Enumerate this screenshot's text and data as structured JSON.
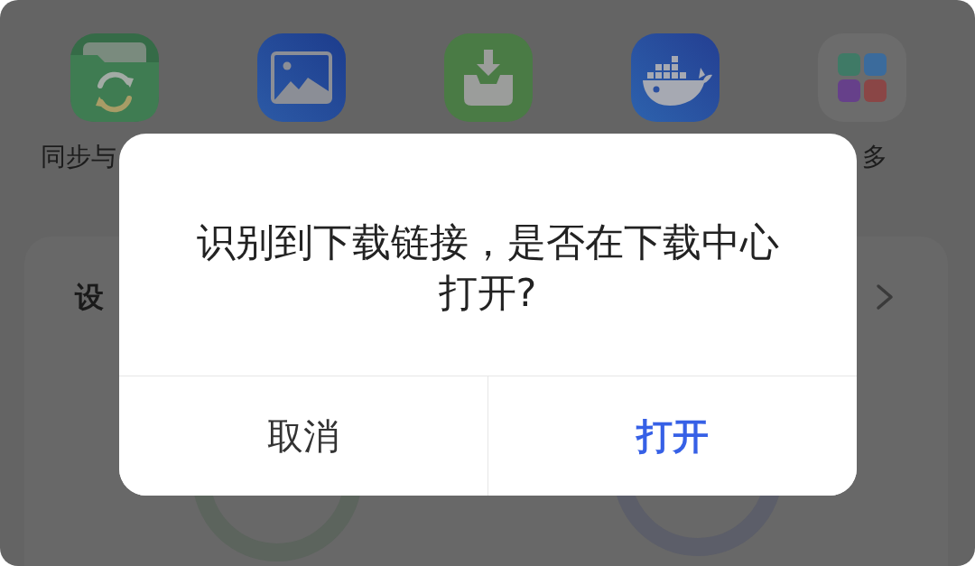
{
  "home": {
    "apps": [
      {
        "kind": "folder-sync",
        "label": "同步与"
      },
      {
        "kind": "picture"
      },
      {
        "kind": "download"
      },
      {
        "kind": "whale"
      },
      {
        "kind": "grid",
        "label": "多"
      }
    ]
  },
  "device_card": {
    "title": "设"
  },
  "dialog": {
    "message": "识别到下载链接，是否在下载中心打开?",
    "buttons": [
      {
        "kind": "cancel",
        "label": "取消"
      },
      {
        "kind": "primary",
        "label": "打开"
      }
    ]
  }
}
